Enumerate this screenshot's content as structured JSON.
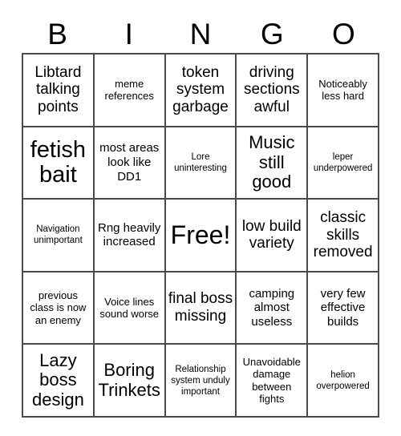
{
  "header": {
    "letters": [
      "B",
      "I",
      "N",
      "G",
      "O"
    ]
  },
  "grid": {
    "rows": [
      [
        {
          "text": "Libtard talking points",
          "size": "fs-md"
        },
        {
          "text": "meme references",
          "size": "fs-xs"
        },
        {
          "text": "token system garbage",
          "size": "fs-md"
        },
        {
          "text": "driving sections awful",
          "size": "fs-md"
        },
        {
          "text": "Noticeably less hard",
          "size": "fs-xs"
        }
      ],
      [
        {
          "text": "fetish bait",
          "size": "fs-xl"
        },
        {
          "text": "most areas look like DD1",
          "size": "fs-sm"
        },
        {
          "text": "Lore uninteresting",
          "size": "fs-xxs"
        },
        {
          "text": "Music still good",
          "size": "fs-lg"
        },
        {
          "text": "leper underpowered",
          "size": "fs-xxs"
        }
      ],
      [
        {
          "text": "Navigation unimportant",
          "size": "fs-xxs"
        },
        {
          "text": "Rng heavily increased",
          "size": "fs-sm"
        },
        {
          "text": "Free!",
          "size": "fs-xxl"
        },
        {
          "text": "low build variety",
          "size": "fs-md"
        },
        {
          "text": "classic skills removed",
          "size": "fs-md"
        }
      ],
      [
        {
          "text": "previous class is now an enemy",
          "size": "fs-xs"
        },
        {
          "text": "Voice lines sound worse",
          "size": "fs-xs"
        },
        {
          "text": "final boss missing",
          "size": "fs-md"
        },
        {
          "text": "camping almost useless",
          "size": "fs-sm"
        },
        {
          "text": "very few effective builds",
          "size": "fs-sm"
        }
      ],
      [
        {
          "text": "Lazy boss design",
          "size": "fs-lg"
        },
        {
          "text": "Boring Trinkets",
          "size": "fs-lg"
        },
        {
          "text": "Relationship system unduly important",
          "size": "fs-xxs"
        },
        {
          "text": "Unavoidable damage between fights",
          "size": "fs-xs"
        },
        {
          "text": "helion overpowered",
          "size": "fs-xxs"
        }
      ]
    ]
  },
  "colors": {
    "background": "#ffffff",
    "text": "#000000",
    "border": "#4a4a4a"
  }
}
